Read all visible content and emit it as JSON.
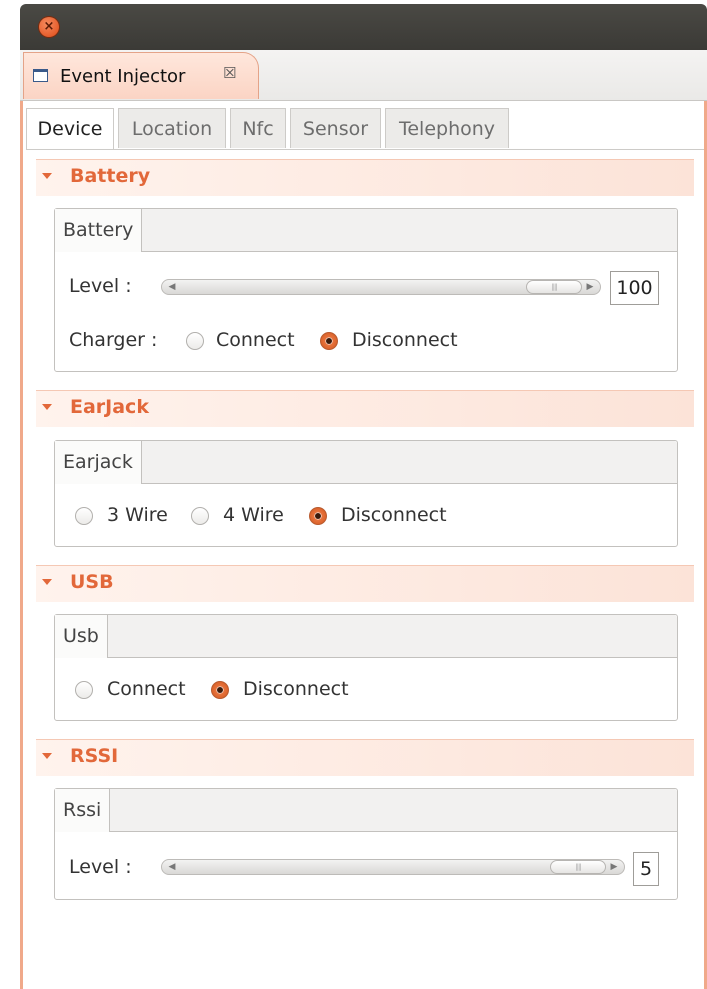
{
  "window": {
    "close_glyph": "×"
  },
  "view": {
    "title": "Event Injector",
    "close_glyph": "☒"
  },
  "tabs": [
    "Device",
    "Location",
    "Nfc",
    "Sensor",
    "Telephony"
  ],
  "active_tab": "Device",
  "accent_color": "#e2683a",
  "battery": {
    "header": "Battery",
    "group_tab": "Battery",
    "level_label": "Level   :",
    "level_value": "100",
    "level_fraction": 1.0,
    "charger_label": "Charger :",
    "options": [
      "Connect",
      "Disconnect"
    ],
    "selected": "Disconnect"
  },
  "earjack": {
    "header": "EarJack",
    "group_tab": "Earjack",
    "options": [
      "3 Wire",
      "4 Wire",
      "Disconnect"
    ],
    "selected": "Disconnect"
  },
  "usb": {
    "header": "USB",
    "group_tab": "Usb",
    "options": [
      "Connect",
      "Disconnect"
    ],
    "selected": "Disconnect"
  },
  "rssi": {
    "header": "RSSI",
    "group_tab": "Rssi",
    "level_label": "Level   :",
    "level_value": "5",
    "level_fraction": 1.0
  }
}
